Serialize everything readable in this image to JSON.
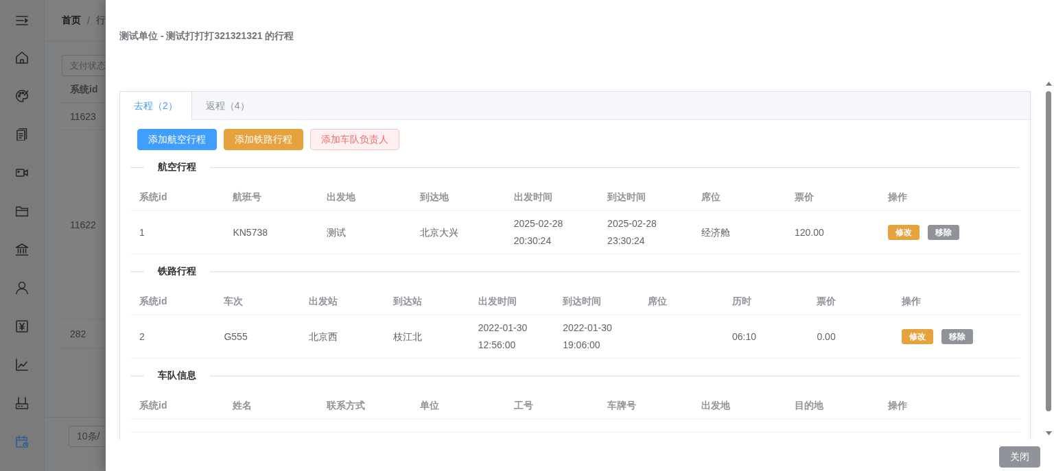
{
  "background": {
    "sidebar": {
      "items": [
        {
          "selected": false
        },
        {
          "selected": false
        },
        {
          "selected": false
        },
        {
          "selected": false
        },
        {
          "selected": false
        },
        {
          "selected": false
        },
        {
          "selected": false
        },
        {
          "selected": false
        },
        {
          "selected": false
        },
        {
          "selected": false
        },
        {
          "selected": true
        }
      ]
    },
    "breadcrumb": {
      "items": [
        "首页",
        "行"
      ],
      "separator": "/"
    },
    "filter": {
      "placeholder": "支付状态"
    },
    "table": {
      "columns": [
        "系统id"
      ],
      "rows": [
        "11623",
        "11622",
        "282"
      ]
    },
    "pagination": {
      "page_size": "10条/"
    }
  },
  "drawer": {
    "title": "测试单位 - 测试打打打321321321 的行程",
    "tabs": [
      {
        "label": "去程（2）",
        "selected": true
      },
      {
        "label": "返程（4）",
        "selected": false
      }
    ],
    "actions": [
      {
        "label": "添加航空行程",
        "kind": "primary"
      },
      {
        "label": "添加铁路行程",
        "kind": "warning"
      },
      {
        "label": "添加车队负责人",
        "kind": "danger-plain"
      }
    ],
    "sections": [
      {
        "title": "航空行程",
        "columns": [
          "系统id",
          "航班号",
          "出发地",
          "到达地",
          "出发时间",
          "到达时间",
          "席位",
          "票价",
          "操作"
        ],
        "rows": [
          {
            "cells": [
              "1",
              "KN5738",
              "测试",
              "北京大兴",
              "2025-02-28 20:30:24",
              "2025-02-28 23:30:24",
              "经济舱",
              "120.00"
            ],
            "actions": [
              {
                "label": "修改",
                "kind": "warning"
              },
              {
                "label": "移除",
                "kind": "info"
              }
            ]
          }
        ]
      },
      {
        "title": "铁路行程",
        "columns": [
          "系统id",
          "车次",
          "出发站",
          "到达站",
          "出发时间",
          "到达时间",
          "席位",
          "历时",
          "票价",
          "操作"
        ],
        "rows": [
          {
            "cells": [
              "2",
              "G555",
              "北京西",
              "枝江北",
              "2022-01-30 12:56:00",
              "2022-01-30 19:06:00",
              null,
              "06:10",
              "0.00"
            ],
            "actions": [
              {
                "label": "修改",
                "kind": "warning"
              },
              {
                "label": "移除",
                "kind": "info"
              }
            ]
          }
        ]
      },
      {
        "title": "车队信息",
        "columns": [
          "系统id",
          "姓名",
          "联系方式",
          "单位",
          "工号",
          "车牌号",
          "出发地",
          "目的地",
          "操作"
        ]
      }
    ],
    "footer_buttons": [
      {
        "label": "关闭",
        "kind": "info"
      }
    ]
  }
}
